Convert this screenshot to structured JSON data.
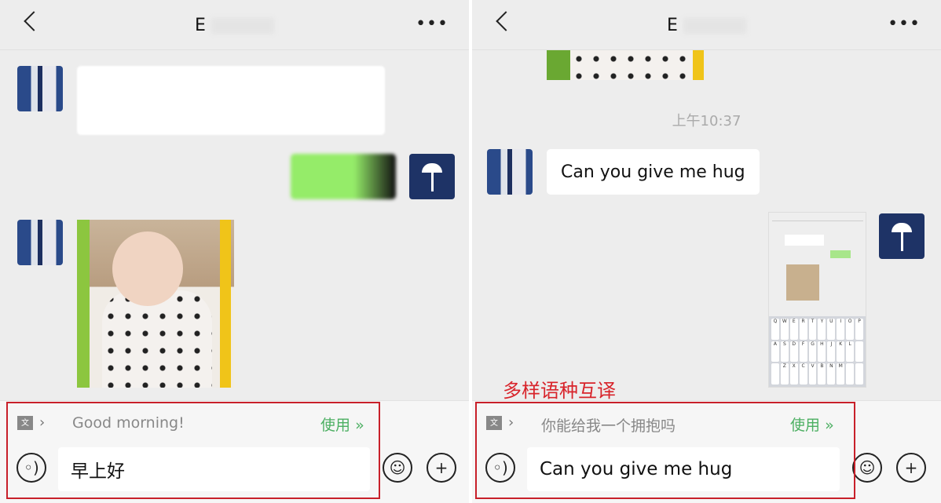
{
  "left": {
    "header": {
      "title": "E",
      "more": "•••"
    },
    "translation": {
      "text": "Good morning!",
      "use_label": "使用",
      "use_icon": "double-chevron-down-icon"
    },
    "input": {
      "value": "早上好"
    },
    "icons": {
      "voice": "voice-icon",
      "emoji": "emoji-icon",
      "plus": "plus-icon"
    }
  },
  "right": {
    "header": {
      "title": "E",
      "more": "•••"
    },
    "timestamp": "上午10:37",
    "received_message": "Can you give me hug",
    "translation": {
      "text": "你能给我一个拥抱吗",
      "use_label": "使用"
    },
    "input": {
      "value": "Can you give me hug"
    }
  },
  "caption": "多样语种互译",
  "colors": {
    "accent_green": "#4caf62",
    "highlight_red": "#c8202a",
    "sent_bubble": "#95ec69"
  }
}
